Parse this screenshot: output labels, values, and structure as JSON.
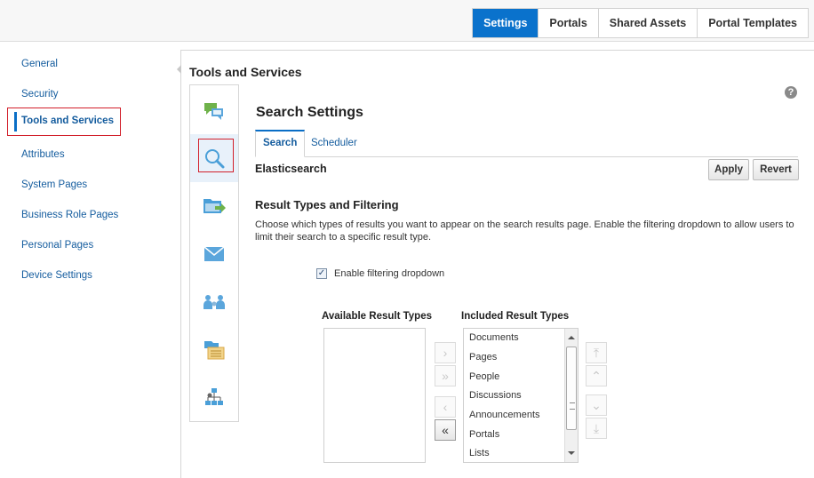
{
  "top_nav": {
    "tabs": [
      {
        "label": "Settings",
        "active": true
      },
      {
        "label": "Portals",
        "active": false
      },
      {
        "label": "Shared Assets",
        "active": false
      },
      {
        "label": "Portal Templates",
        "active": false
      }
    ]
  },
  "left_nav": {
    "items": [
      "General",
      "Security",
      "Tools and Services",
      "Attributes",
      "System Pages",
      "Business Role Pages",
      "Personal Pages",
      "Device Settings"
    ],
    "selected": "Tools and Services"
  },
  "panel": {
    "title": "Tools and Services",
    "help_icon": "?",
    "rail_icons": [
      "feedback-icon",
      "search-icon",
      "folder-export-icon",
      "mail-icon",
      "people-icon",
      "list-icon",
      "hierarchy-icon"
    ],
    "selected_rail_icon": "search-icon"
  },
  "search_settings": {
    "title": "Search Settings",
    "tabs": [
      "Search",
      "Scheduler"
    ],
    "active_tab": "Search",
    "engine_label": "Elasticsearch",
    "apply_label": "Apply",
    "revert_label": "Revert",
    "section_title": "Result Types and Filtering",
    "section_desc": "Choose which types of results you want to appear on the search results page. Enable the filtering dropdown to allow users to limit their search to a specific result type.",
    "enable_filter": {
      "label": "Enable filtering dropdown",
      "checked": true
    },
    "available_title": "Available Result Types",
    "available_items": [],
    "included_title": "Included Result Types",
    "included_items": [
      "Documents",
      "Pages",
      "People",
      "Discussions",
      "Announcements",
      "Portals",
      "Lists"
    ],
    "shuttle_buttons": {
      "move": "›",
      "move_all": "»",
      "remove": "‹",
      "remove_all": "«"
    },
    "order_buttons": {
      "top": "⤒",
      "up": "⌃",
      "down": "⌄",
      "bottom": "⤓"
    }
  },
  "colors": {
    "accent": "#0a72cc",
    "highlight_box": "#d21f2a",
    "link": "#145c9e"
  }
}
